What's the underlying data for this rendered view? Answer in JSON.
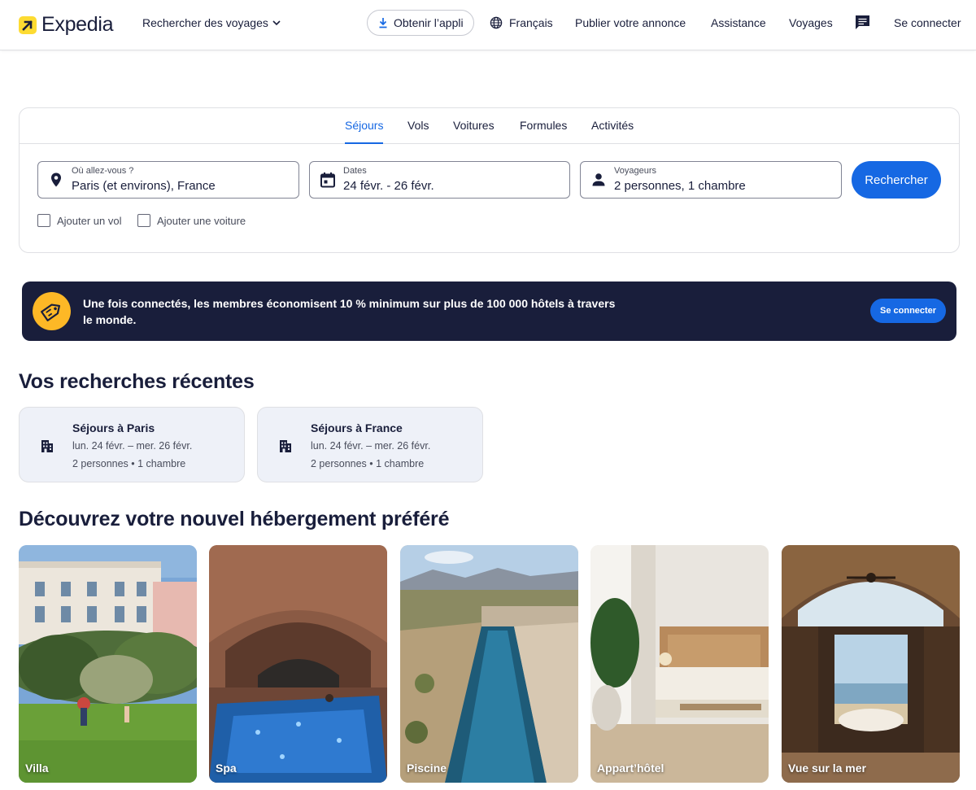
{
  "header": {
    "logo_text": "Expedia",
    "search_trips": "Rechercher des voyages",
    "get_app": "Obtenir l’appli",
    "language": "Français",
    "list_property": "Publier votre annonce",
    "support": "Assistance",
    "trips": "Voyages",
    "sign_in": "Se connecter"
  },
  "search": {
    "tabs": [
      "Séjours",
      "Vols",
      "Voitures",
      "Formules",
      "Activités"
    ],
    "active_tab": "Séjours",
    "destination": {
      "label": "Où allez-vous ?",
      "value": "Paris (et environs), France"
    },
    "dates": {
      "label": "Dates",
      "value": "24 févr. - 26 févr."
    },
    "travelers": {
      "label": "Voyageurs",
      "value": "2 personnes, 1 chambre"
    },
    "search_button": "Rechercher",
    "add_flight": "Ajouter un vol",
    "add_car": "Ajouter une voiture"
  },
  "banner": {
    "text": "Une fois connectés, les membres économisent 10 % minimum sur plus de 100 000 hôtels à travers le monde.",
    "button": "Se connecter"
  },
  "recent": {
    "title": "Vos recherches récentes",
    "items": [
      {
        "title": "Séjours à Paris",
        "dates": "lun. 24 févr. – mer. 26 févr.",
        "details": "2 personnes • 1 chambre"
      },
      {
        "title": "Séjours à France",
        "dates": "lun. 24 févr. – mer. 26 févr.",
        "details": "2 personnes • 1 chambre"
      }
    ]
  },
  "discover": {
    "title": "Découvrez votre nouvel hébergement préféré",
    "tiles": [
      "Villa",
      "Spa",
      "Piscine",
      "Appart’hôtel",
      "Vue sur la mer"
    ]
  },
  "colors": {
    "brand_blue": "#1668e3",
    "navy": "#191e3b",
    "brand_yellow": "#fddb32"
  }
}
